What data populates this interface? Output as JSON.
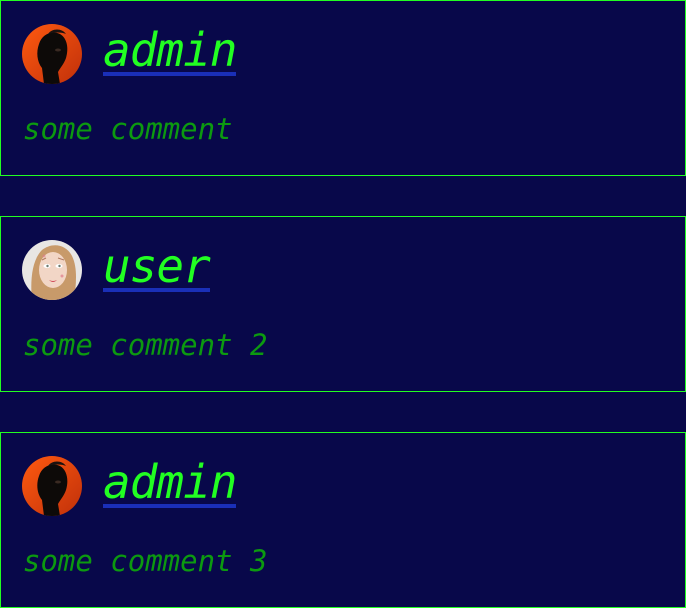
{
  "comments": [
    {
      "username": "admin",
      "text": "some comment",
      "avatar": "admin-avatar"
    },
    {
      "username": "user",
      "text": "some comment 2",
      "avatar": "user-avatar"
    },
    {
      "username": "admin",
      "text": "some comment 3",
      "avatar": "admin-avatar"
    }
  ],
  "colors": {
    "background": "#08084a",
    "border": "#22ff22",
    "username": "#22ff22",
    "username_underline": "#1a2fb8",
    "comment": "#0c9a10"
  }
}
